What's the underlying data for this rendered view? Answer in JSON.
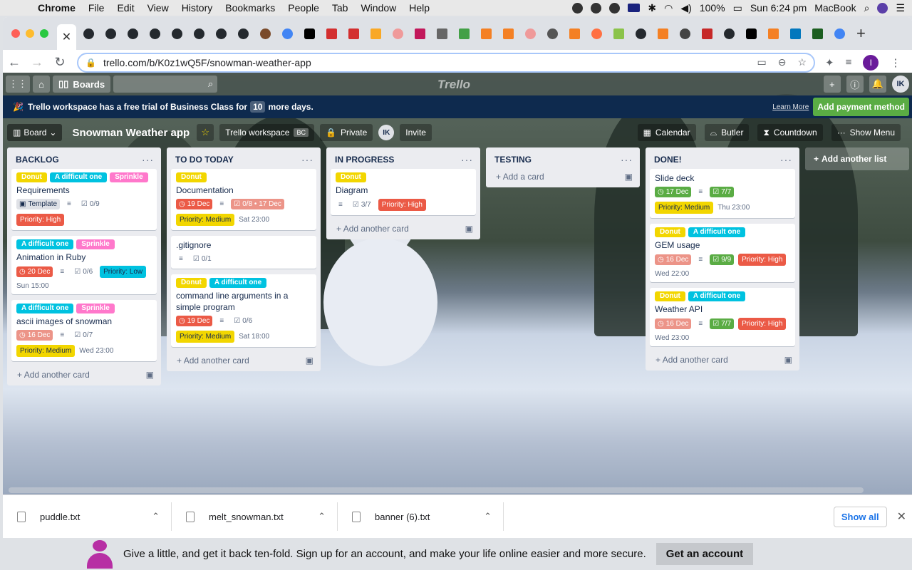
{
  "menubar": {
    "app": "Chrome",
    "items": [
      "File",
      "Edit",
      "View",
      "History",
      "Bookmarks",
      "People",
      "Tab",
      "Window",
      "Help"
    ],
    "battery": "100%",
    "clock": "Sun 6:24 pm",
    "computer": "MacBook"
  },
  "browser": {
    "url": "trello.com/b/K0z1wQ5F/snowman-weather-app"
  },
  "trello": {
    "boards_label": "Boards",
    "logo": "Trello",
    "avatar": "IK",
    "trial": {
      "prefix": "Trello workspace has a free trial of Business Class for",
      "days": "10",
      "suffix": "more days.",
      "learn_more": "Learn More",
      "add_payment": "Add payment method"
    },
    "board": {
      "view": "Board",
      "title": "Snowman Weather app",
      "workspace": "Trello workspace",
      "workspace_badge": "BC",
      "visibility": "Private",
      "member": "IK",
      "invite": "Invite",
      "calendar": "Calendar",
      "butler": "Butler",
      "countdown": "Countdown",
      "show_menu": "Show Menu",
      "add_list": "Add another list"
    },
    "lists": [
      {
        "title": "BACKLOG",
        "add": "Add another card",
        "cards": [
          {
            "labels": [
              {
                "t": "Donut",
                "c": "#f2d600"
              },
              {
                "t": "A difficult one",
                "c": "#00c2e0"
              },
              {
                "t": "Sprinkle",
                "c": "#ff78cb"
              }
            ],
            "title": "Requirements",
            "template": "Template",
            "checklist": "0/9",
            "priority": {
              "t": "Priority: High",
              "c": "red"
            }
          },
          {
            "labels": [
              {
                "t": "A difficult one",
                "c": "#00c2e0"
              },
              {
                "t": "Sprinkle",
                "c": "#ff78cb"
              }
            ],
            "title": "Animation in Ruby",
            "due": {
              "t": "20 Dec",
              "c": "red"
            },
            "checklist": "0/6",
            "priority": {
              "t": "Priority: Low",
              "c": "blue"
            },
            "when": "Sun 15:00"
          },
          {
            "labels": [
              {
                "t": "A difficult one",
                "c": "#00c2e0"
              },
              {
                "t": "Sprinkle",
                "c": "#ff78cb"
              }
            ],
            "title": "ascii images of snowman",
            "due": {
              "t": "16 Dec",
              "c": "pink"
            },
            "checklist": "0/7",
            "priority": {
              "t": "Priority: Medium",
              "c": "yellow"
            },
            "when": "Wed 23:00"
          }
        ]
      },
      {
        "title": "TO DO TODAY",
        "add": "Add another card",
        "cards": [
          {
            "labels": [
              {
                "t": "Donut",
                "c": "#f2d600"
              }
            ],
            "title": "Documentation",
            "due": {
              "t": "19 Dec",
              "c": "red"
            },
            "checklist_due": "0/8 • 17 Dec",
            "priority": {
              "t": "Priority: Medium",
              "c": "yellow"
            },
            "when": "Sat 23:00"
          },
          {
            "labels": [],
            "title": ".gitignore",
            "checklist": "0/1"
          },
          {
            "labels": [
              {
                "t": "Donut",
                "c": "#f2d600"
              },
              {
                "t": "A difficult one",
                "c": "#00c2e0"
              }
            ],
            "title": "command line arguments in a simple program",
            "due": {
              "t": "19 Dec",
              "c": "red"
            },
            "checklist": "0/6",
            "priority": {
              "t": "Priority: Medium",
              "c": "yellow"
            },
            "when": "Sat 18:00"
          }
        ]
      },
      {
        "title": "IN PROGRESS",
        "add": "Add another card",
        "cards": [
          {
            "labels": [
              {
                "t": "Donut",
                "c": "#f2d600"
              }
            ],
            "title": "Diagram",
            "checklist": "3/7",
            "priority": {
              "t": "Priority: High",
              "c": "red"
            }
          }
        ]
      },
      {
        "title": "TESTING",
        "add": "Add a card",
        "cards": []
      },
      {
        "title": "DONE!",
        "add": "Add another card",
        "cards": [
          {
            "labels": [],
            "title": "Slide deck",
            "due": {
              "t": "17 Dec",
              "c": "green"
            },
            "checklist_done": "7/7",
            "priority": {
              "t": "Priority: Medium",
              "c": "yellow"
            },
            "when": "Thu 23:00"
          },
          {
            "labels": [
              {
                "t": "Donut",
                "c": "#f2d600"
              },
              {
                "t": "A difficult one",
                "c": "#00c2e0"
              }
            ],
            "title": "GEM usage",
            "due": {
              "t": "16 Dec",
              "c": "pink"
            },
            "checklist_done": "9/9",
            "priority": {
              "t": "Priority: High",
              "c": "red"
            },
            "when": "Wed 22:00"
          },
          {
            "labels": [
              {
                "t": "Donut",
                "c": "#f2d600"
              },
              {
                "t": "A difficult one",
                "c": "#00c2e0"
              }
            ],
            "title": "Weather API",
            "due": {
              "t": "16 Dec",
              "c": "pink"
            },
            "checklist_done": "7/7",
            "priority": {
              "t": "Priority: High",
              "c": "red"
            },
            "when": "Wed 23:00"
          }
        ]
      }
    ]
  },
  "downloads": {
    "files": [
      "puddle.txt",
      "melt_snowman.txt",
      "banner (6).txt"
    ],
    "show_all": "Show all"
  },
  "behind": {
    "message": "Give a little, and get it back ten-fold. Sign up for an account, and make your life online easier and more secure.",
    "cta": "Get an account"
  }
}
